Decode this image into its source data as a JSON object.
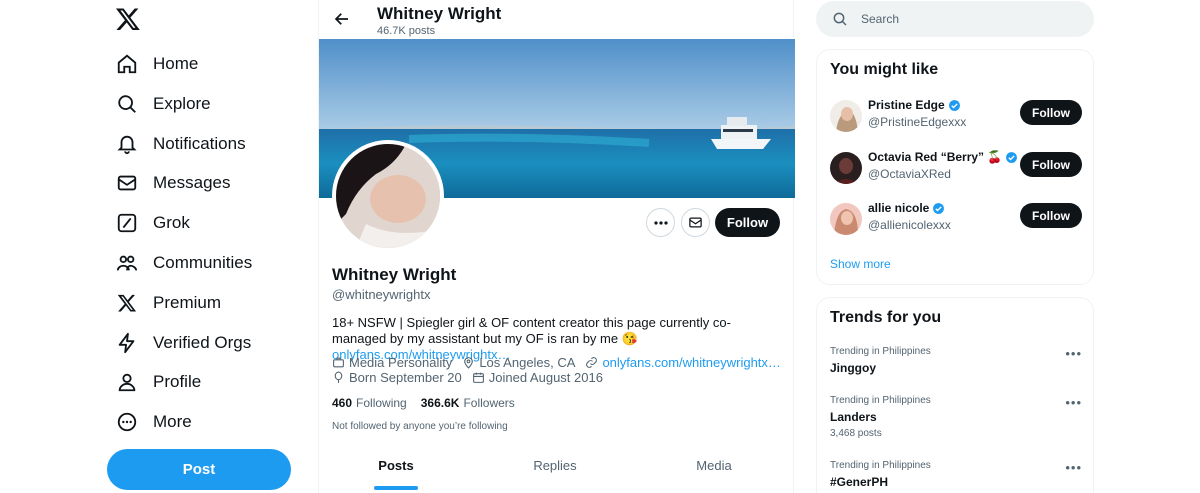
{
  "nav": {
    "items": [
      {
        "label": "Home",
        "icon": "home-icon"
      },
      {
        "label": "Explore",
        "icon": "search-icon"
      },
      {
        "label": "Notifications",
        "icon": "bell-icon"
      },
      {
        "label": "Messages",
        "icon": "envelope-icon"
      },
      {
        "label": "Grok",
        "icon": "grok-icon"
      },
      {
        "label": "Communities",
        "icon": "people-icon"
      },
      {
        "label": "Premium",
        "icon": "x-logo-icon"
      },
      {
        "label": "Verified Orgs",
        "icon": "lightning-icon"
      },
      {
        "label": "Profile",
        "icon": "person-icon"
      },
      {
        "label": "More",
        "icon": "more-circle-icon"
      }
    ],
    "post_label": "Post"
  },
  "header": {
    "name": "Whitney Wright",
    "post_count": "46.7K posts"
  },
  "profile": {
    "name": "Whitney Wright",
    "handle": "@whitneywrightx",
    "follow_label": "Follow",
    "bio_text": "18+ NSFW | Spiegler girl & OF content creator this page currently co-managed by my assistant but my OF is ran by me 😘 ",
    "bio_link": "onlyfans.com/whitneywrightx…",
    "category": "Media Personality",
    "location": "Los Angeles, CA",
    "website": "onlyfans.com/whitneywrightx…",
    "born": "Born September 20",
    "joined": "Joined August 2016",
    "following_count": "460",
    "following_label": "Following",
    "followers_count": "366.6K",
    "followers_label": "Followers",
    "not_followed": "Not followed by anyone you’re following"
  },
  "tabs": [
    {
      "label": "Posts",
      "active": true
    },
    {
      "label": "Replies",
      "active": false
    },
    {
      "label": "Media",
      "active": false
    }
  ],
  "search": {
    "placeholder": "Search"
  },
  "who_to_follow": {
    "title": "You might like",
    "users": [
      {
        "name": "Pristine Edge",
        "handle": "@PristineEdgexxx",
        "follow_label": "Follow"
      },
      {
        "name": "Octavia Red “Berry” 🍒",
        "handle": "@OctaviaXRed",
        "follow_label": "Follow"
      },
      {
        "name": "allie nicole",
        "handle": "@allienicolexxx",
        "follow_label": "Follow"
      }
    ],
    "show_more": "Show more"
  },
  "trends": {
    "title": "Trends for you",
    "items": [
      {
        "context": "Trending in Philippines",
        "name": "Jinggoy",
        "posts": ""
      },
      {
        "context": "Trending in Philippines",
        "name": "Landers",
        "posts": "3,468 posts"
      },
      {
        "context": "Trending in Philippines",
        "name": "#GenerPH",
        "posts": ""
      }
    ]
  },
  "colors": {
    "accent": "#1d9bf0",
    "text": "#0f1419",
    "muted": "#536471",
    "button_dark": "#0f1419",
    "verified": "#1d9bf0"
  }
}
